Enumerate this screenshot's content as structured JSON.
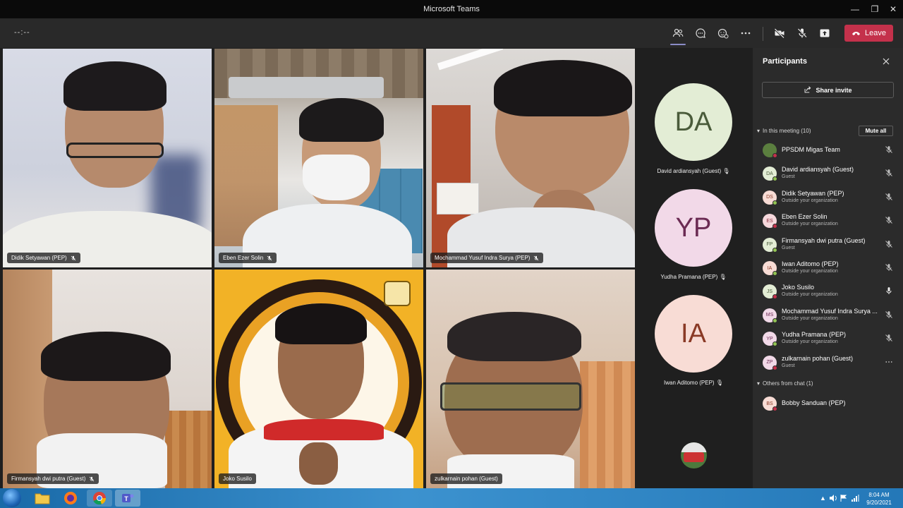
{
  "window": {
    "title": "Microsoft Teams",
    "minimize": "—",
    "restore": "❐",
    "close": "✕"
  },
  "toolbar": {
    "timer": "--:--",
    "leave_label": "Leave"
  },
  "tiles": [
    {
      "name": "Didik Setyawan (PEP)"
    },
    {
      "name": "Eben Ezer Solin"
    },
    {
      "name": "Mochammad Yusuf Indra Surya (PEP)"
    },
    {
      "name": "Firmansyah dwi putra (Guest)"
    },
    {
      "name": "Joko Susilo"
    },
    {
      "name": "zulkarnain pohan (Guest)"
    }
  ],
  "strip": [
    {
      "initials": "DA",
      "name": "David ardiansyah (Guest)",
      "bg": "#e3edd5",
      "fg": "#4a5b3a"
    },
    {
      "initials": "YP",
      "name": "Yudha Pramana (PEP)",
      "bg": "#f2d9e8",
      "fg": "#6b2b53"
    },
    {
      "initials": "IA",
      "name": "Iwan Aditomo (PEP)",
      "bg": "#f8dcd5",
      "fg": "#8a3a26"
    }
  ],
  "panel": {
    "title": "Participants",
    "share_invite": "Share invite",
    "in_meeting_label": "In this meeting (10)",
    "mute_all": "Mute all",
    "others_label": "Others from chat (1)",
    "participants": [
      {
        "initials": "",
        "name": "PPSDM Migas Team",
        "sub": "",
        "bg": "#5b7f3f",
        "fg": "#fff",
        "mic": "muted"
      },
      {
        "initials": "DA",
        "name": "David ardiansyah (Guest)",
        "sub": "Guest",
        "bg": "#e3edd5",
        "fg": "#4a5b3a",
        "mic": "muted"
      },
      {
        "initials": "DS",
        "name": "Didik Setyawan (PEP)",
        "sub": "Outside your organization",
        "bg": "#f8dcd5",
        "fg": "#8a3a26",
        "mic": "muted"
      },
      {
        "initials": "ES",
        "name": "Eben Ezer Solin",
        "sub": "Outside your organization",
        "bg": "#f6d8dc",
        "fg": "#8a2e3b",
        "mic": "muted"
      },
      {
        "initials": "FP",
        "name": "Firmansyah dwi putra (Guest)",
        "sub": "Guest",
        "bg": "#e3edd5",
        "fg": "#4a5b3a",
        "mic": "muted"
      },
      {
        "initials": "IA",
        "name": "Iwan Aditomo (PEP)",
        "sub": "Outside your organization",
        "bg": "#f8dcd5",
        "fg": "#8a3a26",
        "mic": "muted"
      },
      {
        "initials": "JS",
        "name": "Joko Susilo",
        "sub": "Outside your organization",
        "bg": "#e3edd5",
        "fg": "#4a5b3a",
        "mic": "on"
      },
      {
        "initials": "MS",
        "name": "Mochammad Yusuf Indra Surya ...",
        "sub": "Outside your organization",
        "bg": "#f2d9e8",
        "fg": "#6b2b53",
        "mic": "muted"
      },
      {
        "initials": "YP",
        "name": "Yudha Pramana (PEP)",
        "sub": "Outside your organization",
        "bg": "#f2d9e8",
        "fg": "#6b2b53",
        "mic": "muted"
      },
      {
        "initials": "ZP",
        "name": "zulkarnain pohan (Guest)",
        "sub": "Guest",
        "bg": "#f2d9e8",
        "fg": "#6b2b53",
        "mic": "more"
      }
    ],
    "others": [
      {
        "initials": "BS",
        "name": "Bobby Sanduan (PEP)",
        "sub": "",
        "bg": "#f8dcd5",
        "fg": "#8a3a26"
      }
    ]
  },
  "taskbar": {
    "time": "8:04 AM",
    "date": "9/20/2021",
    "more_icons": "▲"
  }
}
